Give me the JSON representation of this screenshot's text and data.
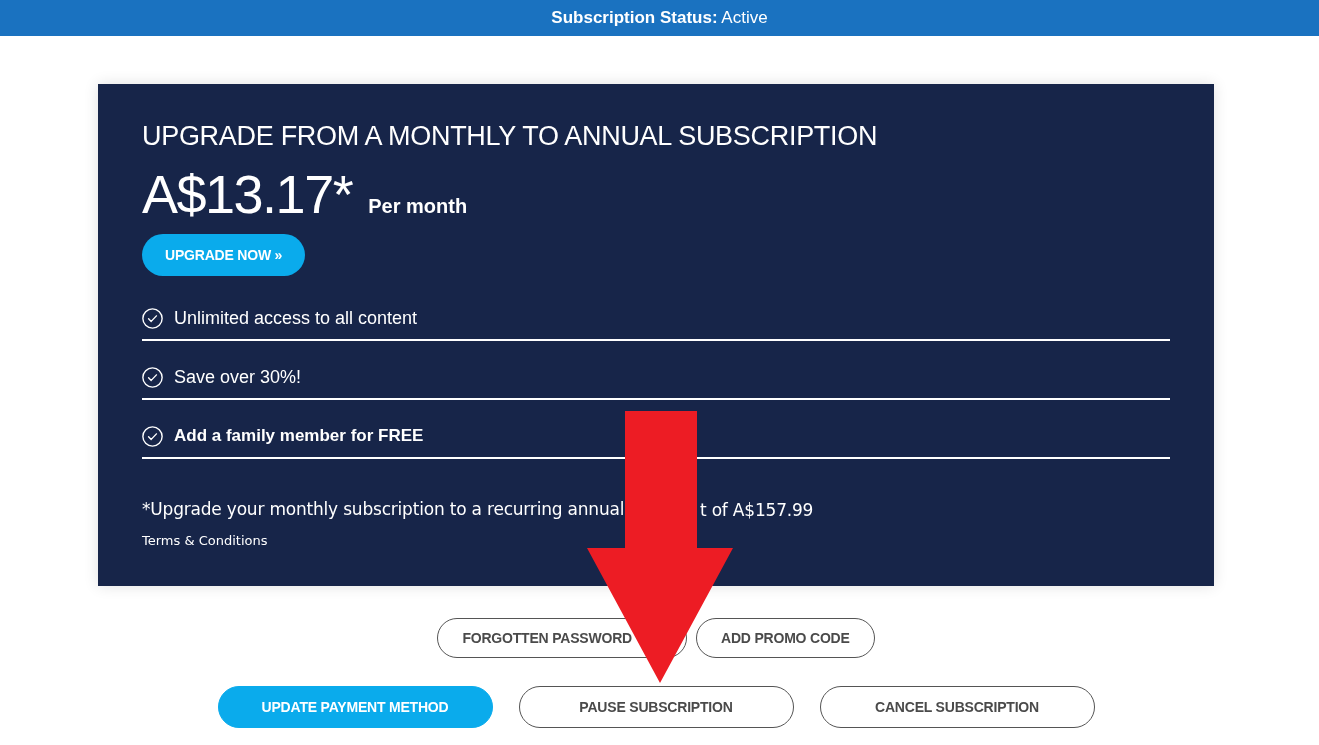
{
  "status_bar": {
    "text": "**Subscription Status:** Active"
  },
  "upgrade_card": {
    "title": "UPGRADE FROM A MONTHLY TO ANNUAL SUBSCRIPTION",
    "price": "A$13.17*",
    "period": "Per month",
    "button": "UPGRADE NOW »",
    "features": [
      {
        "text": "Unlimited access to all content",
        "highlighted": false
      },
      {
        "text": "Save over 30%!",
        "highlighted": false
      },
      {
        "text": "Add a family member for FREE",
        "highlighted": true
      }
    ],
    "footnote": [
      "*Upgrade your monthly subscription to a recurring annual",
      "t of A$157.99"
    ],
    "terms_link": "Terms & Conditions"
  },
  "action_rows": [
    [
      {
        "label": "FORGOTTEN PASSWORD",
        "kind": "outline"
      },
      {
        "label": "ADD PROMO CODE",
        "kind": "outline"
      }
    ],
    [
      {
        "label": "UPDATE PAYMENT METHOD",
        "kind": "primary"
      },
      {
        "label": "PAUSE SUBSCRIPTION",
        "kind": "outline"
      },
      {
        "label": "CANCEL SUBSCRIPTION",
        "kind": "outline"
      }
    ]
  ]
}
